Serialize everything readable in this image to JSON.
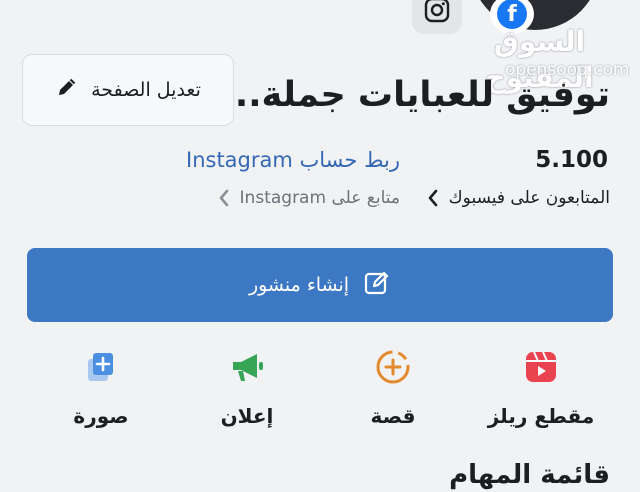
{
  "header": {
    "instagram_icon": "instagram-icon",
    "facebook_icon": "facebook-icon",
    "facebook_glyph": "f"
  },
  "watermark": {
    "arabic": "السوق المفتوح",
    "latin": "opensooq.com"
  },
  "page": {
    "title": "توفيق للعبايات جملة...",
    "edit_label": "تعديل الصفحة"
  },
  "stats": {
    "followers_count": "5.100",
    "followers_label": "المتابعون على فيسبوك",
    "instagram_link": "ربط حساب Instagram",
    "instagram_followers_label": "متابع على Instagram"
  },
  "create_post": {
    "label": "إنشاء منشور"
  },
  "actions": [
    {
      "label": "مقطع ريلز",
      "icon": "reels-icon",
      "color": "#e8434f"
    },
    {
      "label": "قصة",
      "icon": "story-add-icon",
      "color": "#e48a2e"
    },
    {
      "label": "إعلان",
      "icon": "megaphone-icon",
      "color": "#36a556"
    },
    {
      "label": "صورة",
      "icon": "photo-add-icon",
      "color": "#4a8fe0"
    }
  ],
  "section": {
    "title": "قائمة المهام"
  },
  "colors": {
    "primary": "#3d78c4",
    "link": "#3568b4",
    "background": "#f1f2f4"
  }
}
